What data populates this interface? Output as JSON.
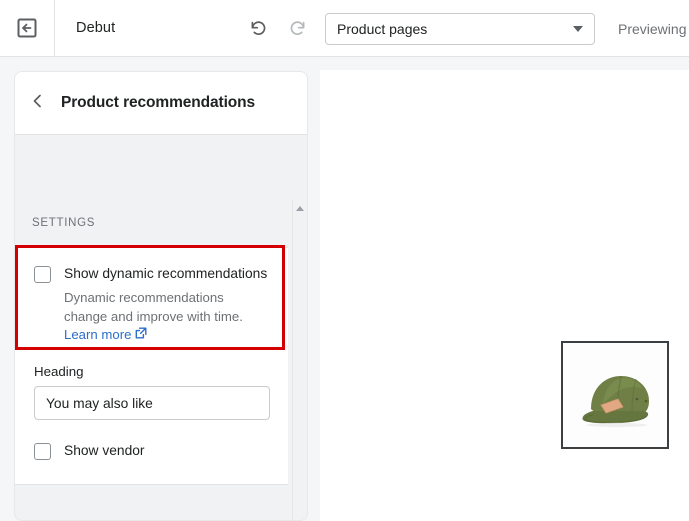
{
  "topbar": {
    "exit_icon": "exit-back-icon",
    "shop_title": "Debut",
    "undo_icon": "undo-icon",
    "redo_icon": "redo-icon",
    "page_selector": {
      "selected": "Product pages",
      "caret_icon": "chevron-down-icon"
    },
    "status": "Previewing"
  },
  "sidebar": {
    "back_icon": "chevron-left-icon",
    "panel_title": "Product recommendations",
    "section_label": "SETTINGS",
    "dynamic_recommendations": {
      "checkbox_label": "Show dynamic recommendations",
      "checked": false,
      "help_text": "Dynamic recommendations change and improve with time.",
      "link_text": "Learn more",
      "link_icon": "external-link-icon"
    },
    "heading_field": {
      "label": "Heading",
      "value": "You may also like",
      "placeholder": "Heading"
    },
    "show_vendor": {
      "checkbox_label": "Show vendor",
      "checked": false
    },
    "scrollbar": {
      "up_arrow_icon": "scroll-up-arrow-icon"
    }
  },
  "preview": {
    "product_image_alt": "olive green five-panel camp hat with tan leather patch"
  },
  "colors": {
    "accent_link": "#2c6ecb",
    "highlight_box": "#d40000",
    "text_primary": "#202223",
    "text_subdued": "#6d7175",
    "panel_bg": "#f1f2f3",
    "page_bg": "#f4f6f8"
  }
}
